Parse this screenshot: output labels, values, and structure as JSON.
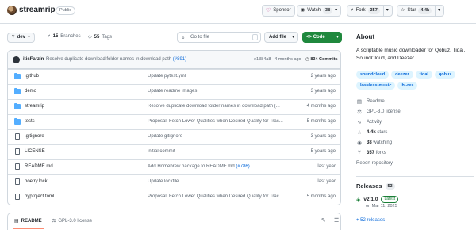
{
  "repo": {
    "name": "streamrip",
    "visibility": "Public"
  },
  "header_actions": {
    "sponsor_label": "Sponsor",
    "watch_label": "Watch",
    "watch_count": "38",
    "fork_label": "Fork",
    "fork_count": "357",
    "star_label": "Star",
    "star_count": "4.4k"
  },
  "toolbar": {
    "branch": "dev",
    "branches": "15",
    "branches_label": "Branches",
    "tags": "55",
    "tags_label": "Tags",
    "go_to_file_placeholder": "Go to file",
    "go_to_file_kbd": "t",
    "add_file_label": "Add file",
    "code_label": "Code"
  },
  "latest_commit": {
    "author": "itisFarzin",
    "message": "Resolve duplicate download folder names in download path",
    "pr": "(#891)",
    "hash_time": "e1384a8 · 4 months ago",
    "commits": "834 Commits"
  },
  "files": [
    {
      "name": ".github",
      "type": "folder",
      "message": "Update pytest.yml",
      "pr": "",
      "age": "2 years ago"
    },
    {
      "name": "demo",
      "type": "folder",
      "message": "Update readme images",
      "pr": "",
      "age": "3 years ago"
    },
    {
      "name": "streamrip",
      "type": "folder",
      "message": "Resolve duplicate download folder names in download path (...",
      "pr": "",
      "age": "4 months ago"
    },
    {
      "name": "tests",
      "type": "folder",
      "message": "Proposal: Fetch Lower Qualities when Desired Quality for Trac...",
      "pr": "",
      "age": "5 months ago"
    },
    {
      "name": ".gitignore",
      "type": "file",
      "message": "Update gitignore",
      "pr": "",
      "age": "3 years ago"
    },
    {
      "name": "LICENSE",
      "type": "file",
      "message": "initial commit",
      "pr": "",
      "age": "5 years ago"
    },
    {
      "name": "README.md",
      "type": "file",
      "message": "Add Homebrew package to README.md ",
      "pr": "(#786)",
      "age": "last year"
    },
    {
      "name": "poetry.lock",
      "type": "file",
      "message": "Update lockfile",
      "pr": "",
      "age": "last year"
    },
    {
      "name": "pyproject.toml",
      "type": "file",
      "message": "Proposal: Fetch Lower Qualities when Desired Quality for Trac...",
      "pr": "",
      "age": "5 months ago"
    }
  ],
  "readme_tabs": {
    "readme": "README",
    "license": "GPL-3.0 license"
  },
  "about": {
    "title": "About",
    "description": "A scriptable music downloader for Qobuz, Tidal, SoundCloud, and Deezer",
    "topics": [
      "soundcloud",
      "deezer",
      "tidal",
      "qobuz",
      "lossless-music",
      "hi-res"
    ],
    "readme": "Readme",
    "license": "GPL-3.0 license",
    "activity": "Activity",
    "stars_value": "4.4k",
    "stars_label": "stars",
    "watching_value": "38",
    "watching_label": "watching",
    "forks_value": "357",
    "forks_label": "forks",
    "report": "Report repository"
  },
  "releases": {
    "title": "Releases",
    "count": "53",
    "latest_tag": "v2.1.0",
    "latest_badge": "Latest",
    "latest_date": "on Mar 11, 2025",
    "more_link": "+ 52 releases"
  },
  "colors": {
    "code_button": "#1f883d",
    "link": "#0969da",
    "folder": "#54aeff",
    "topic_bg": "#ddf4ff"
  }
}
